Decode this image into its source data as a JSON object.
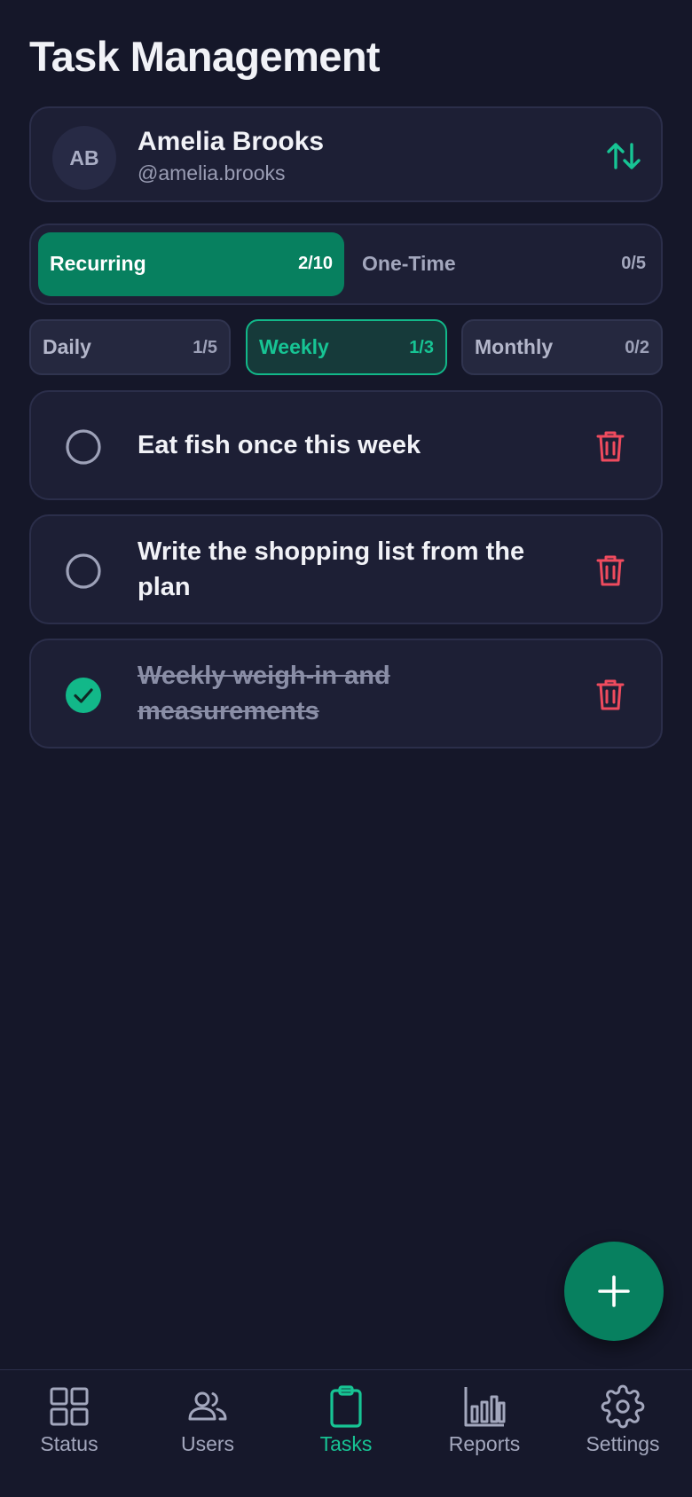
{
  "header": {
    "title": "Task Management"
  },
  "user": {
    "initials": "AB",
    "name": "Amelia Brooks",
    "handle": "@amelia.brooks"
  },
  "main_tabs": [
    {
      "label": "Recurring",
      "count": "2/10",
      "active": true
    },
    {
      "label": "One-Time",
      "count": "0/5",
      "active": false
    }
  ],
  "sub_tabs": [
    {
      "label": "Daily",
      "count": "1/5",
      "active": false
    },
    {
      "label": "Weekly",
      "count": "1/3",
      "active": true
    },
    {
      "label": "Monthly",
      "count": "0/2",
      "active": false
    }
  ],
  "tasks": [
    {
      "text": "Eat fish once this week",
      "completed": false
    },
    {
      "text": "Write the shopping list from the plan",
      "completed": false
    },
    {
      "text": "Weekly weigh-in and measurements",
      "completed": true
    }
  ],
  "bottom_nav": [
    {
      "label": "Status",
      "icon": "grid-icon",
      "active": false
    },
    {
      "label": "Users",
      "icon": "users-icon",
      "active": false
    },
    {
      "label": "Tasks",
      "icon": "clipboard-icon",
      "active": true
    },
    {
      "label": "Reports",
      "icon": "bar-chart-icon",
      "active": false
    },
    {
      "label": "Settings",
      "icon": "gear-icon",
      "active": false
    }
  ],
  "colors": {
    "background": "#151729",
    "card": "#1d1f35",
    "accent": "#07805f",
    "accent_text": "#17c494",
    "danger": "#ef4b5e",
    "muted": "#a3a7bd"
  }
}
